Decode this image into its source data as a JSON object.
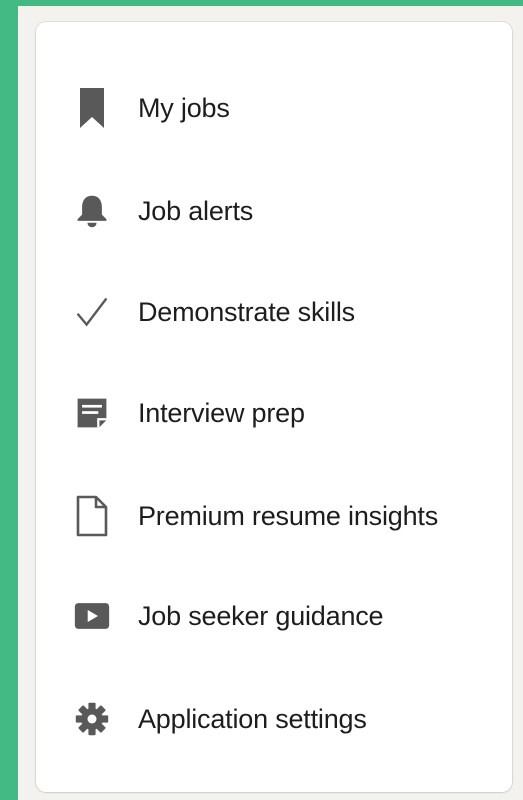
{
  "colors": {
    "frame": "#43b984",
    "icon": "#595959",
    "text": "#1d1d1d"
  },
  "menu": {
    "items": [
      {
        "label": "My jobs",
        "icon": "bookmark-icon"
      },
      {
        "label": "Job alerts",
        "icon": "bell-icon"
      },
      {
        "label": "Demonstrate skills",
        "icon": "checkmark-icon"
      },
      {
        "label": "Interview prep",
        "icon": "notepad-icon"
      },
      {
        "label": "Premium resume insights",
        "icon": "document-icon"
      },
      {
        "label": "Job seeker guidance",
        "icon": "video-play-icon"
      },
      {
        "label": "Application settings",
        "icon": "gear-icon"
      }
    ]
  }
}
